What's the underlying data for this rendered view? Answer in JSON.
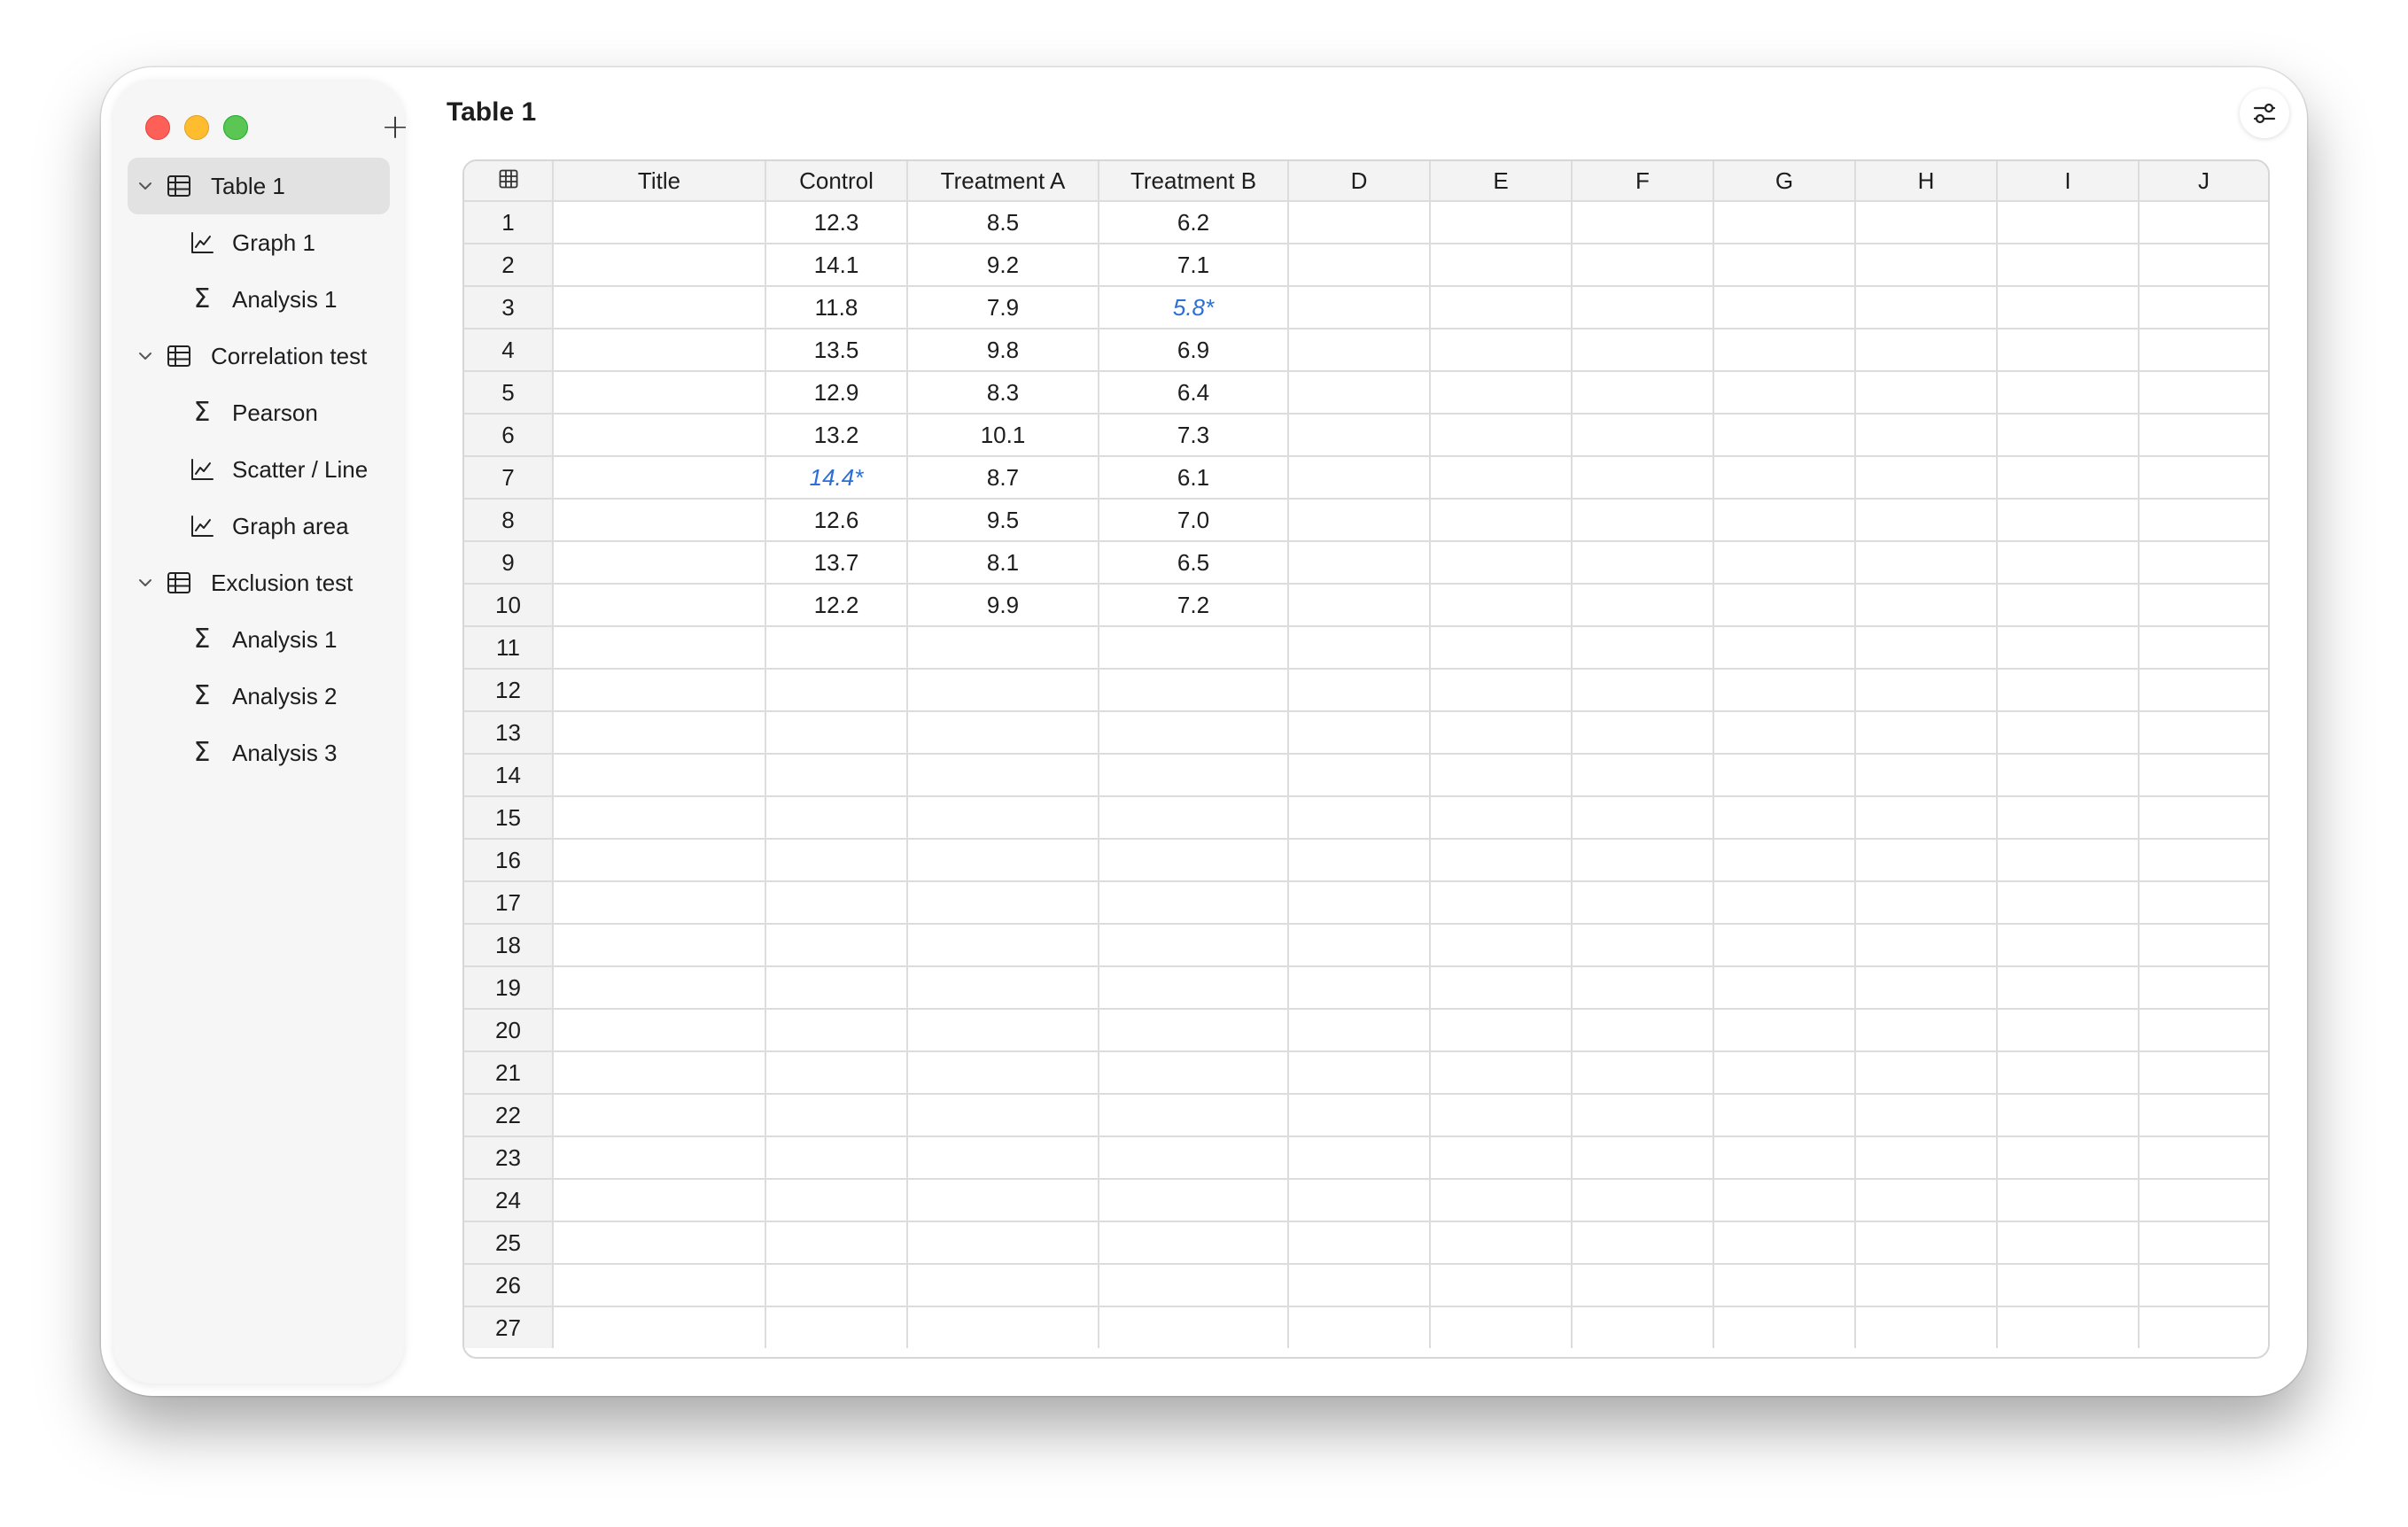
{
  "sidebar": {
    "add_label": "+",
    "items": [
      {
        "label": "Table 1",
        "icon": "table-icon",
        "level": "parent",
        "selected": true
      },
      {
        "label": "Graph 1",
        "icon": "graph-icon",
        "level": "child"
      },
      {
        "label": "Analysis 1",
        "icon": "sigma-icon",
        "level": "child"
      },
      {
        "label": "Correlation test",
        "icon": "table-icon",
        "level": "parent"
      },
      {
        "label": "Pearson",
        "icon": "sigma-icon",
        "level": "child"
      },
      {
        "label": "Scatter / Line",
        "icon": "graph-icon",
        "level": "child"
      },
      {
        "label": "Graph area",
        "icon": "graph-icon",
        "level": "child"
      },
      {
        "label": "Exclusion test",
        "icon": "table-icon",
        "level": "parent"
      },
      {
        "label": "Analysis 1",
        "icon": "sigma-icon",
        "level": "child"
      },
      {
        "label": "Analysis 2",
        "icon": "sigma-icon",
        "level": "child"
      },
      {
        "label": "Analysis 3",
        "icon": "sigma-icon",
        "level": "child"
      }
    ]
  },
  "header": {
    "title": "Table 1"
  },
  "table": {
    "columns": [
      "Title",
      "Control",
      "Treatment A",
      "Treatment B",
      "D",
      "E",
      "F",
      "G",
      "H",
      "I",
      "J"
    ],
    "rows": [
      {
        "num": "1",
        "cells": [
          "",
          "12.3",
          "8.5",
          "6.2",
          "",
          "",
          "",
          "",
          "",
          "",
          ""
        ]
      },
      {
        "num": "2",
        "cells": [
          "",
          "14.1",
          "9.2",
          "7.1",
          "",
          "",
          "",
          "",
          "",
          "",
          ""
        ]
      },
      {
        "num": "3",
        "cells": [
          "",
          "11.8",
          "7.9",
          "5.8*",
          "",
          "",
          "",
          "",
          "",
          "",
          ""
        ]
      },
      {
        "num": "4",
        "cells": [
          "",
          "13.5",
          "9.8",
          "6.9",
          "",
          "",
          "",
          "",
          "",
          "",
          ""
        ]
      },
      {
        "num": "5",
        "cells": [
          "",
          "12.9",
          "8.3",
          "6.4",
          "",
          "",
          "",
          "",
          "",
          "",
          ""
        ]
      },
      {
        "num": "6",
        "cells": [
          "",
          "13.2",
          "10.1",
          "7.3",
          "",
          "",
          "",
          "",
          "",
          "",
          ""
        ]
      },
      {
        "num": "7",
        "cells": [
          "",
          "14.4*",
          "8.7",
          "6.1",
          "",
          "",
          "",
          "",
          "",
          "",
          ""
        ]
      },
      {
        "num": "8",
        "cells": [
          "",
          "12.6",
          "9.5",
          "7.0",
          "",
          "",
          "",
          "",
          "",
          "",
          ""
        ]
      },
      {
        "num": "9",
        "cells": [
          "",
          "13.7",
          "8.1",
          "6.5",
          "",
          "",
          "",
          "",
          "",
          "",
          ""
        ]
      },
      {
        "num": "10",
        "cells": [
          "",
          "12.2",
          "9.9",
          "7.2",
          "",
          "",
          "",
          "",
          "",
          "",
          ""
        ]
      },
      {
        "num": "11",
        "cells": [
          "",
          "",
          "",
          "",
          "",
          "",
          "",
          "",
          "",
          "",
          ""
        ]
      },
      {
        "num": "12",
        "cells": [
          "",
          "",
          "",
          "",
          "",
          "",
          "",
          "",
          "",
          "",
          ""
        ]
      },
      {
        "num": "13",
        "cells": [
          "",
          "",
          "",
          "",
          "",
          "",
          "",
          "",
          "",
          "",
          ""
        ]
      },
      {
        "num": "14",
        "cells": [
          "",
          "",
          "",
          "",
          "",
          "",
          "",
          "",
          "",
          "",
          ""
        ]
      },
      {
        "num": "15",
        "cells": [
          "",
          "",
          "",
          "",
          "",
          "",
          "",
          "",
          "",
          "",
          ""
        ]
      },
      {
        "num": "16",
        "cells": [
          "",
          "",
          "",
          "",
          "",
          "",
          "",
          "",
          "",
          "",
          ""
        ]
      },
      {
        "num": "17",
        "cells": [
          "",
          "",
          "",
          "",
          "",
          "",
          "",
          "",
          "",
          "",
          ""
        ]
      },
      {
        "num": "18",
        "cells": [
          "",
          "",
          "",
          "",
          "",
          "",
          "",
          "",
          "",
          "",
          ""
        ]
      },
      {
        "num": "19",
        "cells": [
          "",
          "",
          "",
          "",
          "",
          "",
          "",
          "",
          "",
          "",
          ""
        ]
      },
      {
        "num": "20",
        "cells": [
          "",
          "",
          "",
          "",
          "",
          "",
          "",
          "",
          "",
          "",
          ""
        ]
      },
      {
        "num": "21",
        "cells": [
          "",
          "",
          "",
          "",
          "",
          "",
          "",
          "",
          "",
          "",
          ""
        ]
      },
      {
        "num": "22",
        "cells": [
          "",
          "",
          "",
          "",
          "",
          "",
          "",
          "",
          "",
          "",
          ""
        ]
      },
      {
        "num": "23",
        "cells": [
          "",
          "",
          "",
          "",
          "",
          "",
          "",
          "",
          "",
          "",
          ""
        ]
      },
      {
        "num": "24",
        "cells": [
          "",
          "",
          "",
          "",
          "",
          "",
          "",
          "",
          "",
          "",
          ""
        ]
      },
      {
        "num": "25",
        "cells": [
          "",
          "",
          "",
          "",
          "",
          "",
          "",
          "",
          "",
          "",
          ""
        ]
      },
      {
        "num": "26",
        "cells": [
          "",
          "",
          "",
          "",
          "",
          "",
          "",
          "",
          "",
          "",
          ""
        ]
      },
      {
        "num": "27",
        "cells": [
          "",
          "",
          "",
          "",
          "",
          "",
          "",
          "",
          "",
          "",
          ""
        ]
      }
    ]
  },
  "icons": {
    "corner": "table-icon",
    "settings": "sliders-icon"
  },
  "colors": {
    "excluded_value": "#2a6ed6",
    "close": "#fe5f57",
    "minimize": "#febc2e",
    "zoom": "#5bc653",
    "selected_item": "#e2e2e2"
  }
}
